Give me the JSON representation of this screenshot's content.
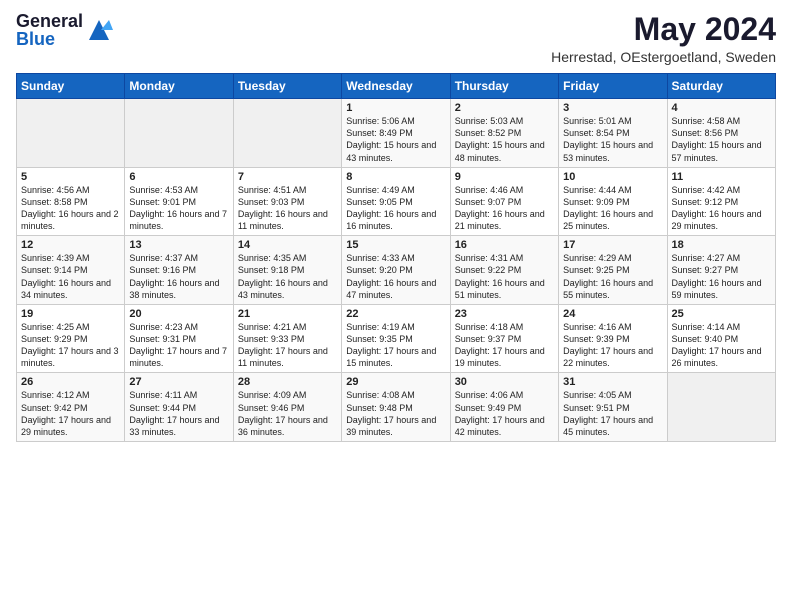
{
  "header": {
    "logo": {
      "general": "General",
      "blue": "Blue"
    },
    "title": "May 2024",
    "subtitle": "Herrestad, OEstergoetland, Sweden"
  },
  "days_of_week": [
    "Sunday",
    "Monday",
    "Tuesday",
    "Wednesday",
    "Thursday",
    "Friday",
    "Saturday"
  ],
  "weeks": [
    [
      {
        "day": "",
        "info": ""
      },
      {
        "day": "",
        "info": ""
      },
      {
        "day": "",
        "info": ""
      },
      {
        "day": "1",
        "info": "Sunrise: 5:06 AM\nSunset: 8:49 PM\nDaylight: 15 hours and 43 minutes."
      },
      {
        "day": "2",
        "info": "Sunrise: 5:03 AM\nSunset: 8:52 PM\nDaylight: 15 hours and 48 minutes."
      },
      {
        "day": "3",
        "info": "Sunrise: 5:01 AM\nSunset: 8:54 PM\nDaylight: 15 hours and 53 minutes."
      },
      {
        "day": "4",
        "info": "Sunrise: 4:58 AM\nSunset: 8:56 PM\nDaylight: 15 hours and 57 minutes."
      }
    ],
    [
      {
        "day": "5",
        "info": "Sunrise: 4:56 AM\nSunset: 8:58 PM\nDaylight: 16 hours and 2 minutes."
      },
      {
        "day": "6",
        "info": "Sunrise: 4:53 AM\nSunset: 9:01 PM\nDaylight: 16 hours and 7 minutes."
      },
      {
        "day": "7",
        "info": "Sunrise: 4:51 AM\nSunset: 9:03 PM\nDaylight: 16 hours and 11 minutes."
      },
      {
        "day": "8",
        "info": "Sunrise: 4:49 AM\nSunset: 9:05 PM\nDaylight: 16 hours and 16 minutes."
      },
      {
        "day": "9",
        "info": "Sunrise: 4:46 AM\nSunset: 9:07 PM\nDaylight: 16 hours and 21 minutes."
      },
      {
        "day": "10",
        "info": "Sunrise: 4:44 AM\nSunset: 9:09 PM\nDaylight: 16 hours and 25 minutes."
      },
      {
        "day": "11",
        "info": "Sunrise: 4:42 AM\nSunset: 9:12 PM\nDaylight: 16 hours and 29 minutes."
      }
    ],
    [
      {
        "day": "12",
        "info": "Sunrise: 4:39 AM\nSunset: 9:14 PM\nDaylight: 16 hours and 34 minutes."
      },
      {
        "day": "13",
        "info": "Sunrise: 4:37 AM\nSunset: 9:16 PM\nDaylight: 16 hours and 38 minutes."
      },
      {
        "day": "14",
        "info": "Sunrise: 4:35 AM\nSunset: 9:18 PM\nDaylight: 16 hours and 43 minutes."
      },
      {
        "day": "15",
        "info": "Sunrise: 4:33 AM\nSunset: 9:20 PM\nDaylight: 16 hours and 47 minutes."
      },
      {
        "day": "16",
        "info": "Sunrise: 4:31 AM\nSunset: 9:22 PM\nDaylight: 16 hours and 51 minutes."
      },
      {
        "day": "17",
        "info": "Sunrise: 4:29 AM\nSunset: 9:25 PM\nDaylight: 16 hours and 55 minutes."
      },
      {
        "day": "18",
        "info": "Sunrise: 4:27 AM\nSunset: 9:27 PM\nDaylight: 16 hours and 59 minutes."
      }
    ],
    [
      {
        "day": "19",
        "info": "Sunrise: 4:25 AM\nSunset: 9:29 PM\nDaylight: 17 hours and 3 minutes."
      },
      {
        "day": "20",
        "info": "Sunrise: 4:23 AM\nSunset: 9:31 PM\nDaylight: 17 hours and 7 minutes."
      },
      {
        "day": "21",
        "info": "Sunrise: 4:21 AM\nSunset: 9:33 PM\nDaylight: 17 hours and 11 minutes."
      },
      {
        "day": "22",
        "info": "Sunrise: 4:19 AM\nSunset: 9:35 PM\nDaylight: 17 hours and 15 minutes."
      },
      {
        "day": "23",
        "info": "Sunrise: 4:18 AM\nSunset: 9:37 PM\nDaylight: 17 hours and 19 minutes."
      },
      {
        "day": "24",
        "info": "Sunrise: 4:16 AM\nSunset: 9:39 PM\nDaylight: 17 hours and 22 minutes."
      },
      {
        "day": "25",
        "info": "Sunrise: 4:14 AM\nSunset: 9:40 PM\nDaylight: 17 hours and 26 minutes."
      }
    ],
    [
      {
        "day": "26",
        "info": "Sunrise: 4:12 AM\nSunset: 9:42 PM\nDaylight: 17 hours and 29 minutes."
      },
      {
        "day": "27",
        "info": "Sunrise: 4:11 AM\nSunset: 9:44 PM\nDaylight: 17 hours and 33 minutes."
      },
      {
        "day": "28",
        "info": "Sunrise: 4:09 AM\nSunset: 9:46 PM\nDaylight: 17 hours and 36 minutes."
      },
      {
        "day": "29",
        "info": "Sunrise: 4:08 AM\nSunset: 9:48 PM\nDaylight: 17 hours and 39 minutes."
      },
      {
        "day": "30",
        "info": "Sunrise: 4:06 AM\nSunset: 9:49 PM\nDaylight: 17 hours and 42 minutes."
      },
      {
        "day": "31",
        "info": "Sunrise: 4:05 AM\nSunset: 9:51 PM\nDaylight: 17 hours and 45 minutes."
      },
      {
        "day": "",
        "info": ""
      }
    ]
  ]
}
